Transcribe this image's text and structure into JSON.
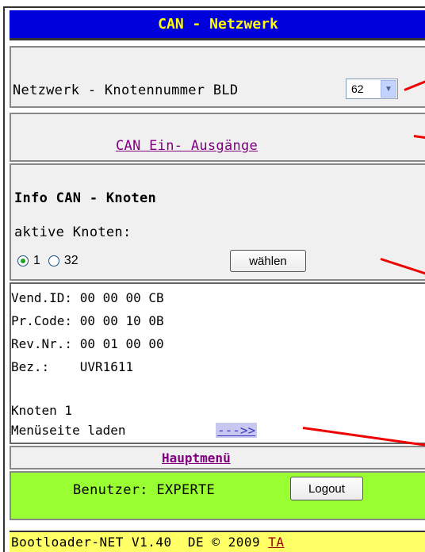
{
  "header": {
    "title": "CAN - Netzwerk"
  },
  "network": {
    "label": "Netzwerk - Knotennummer BLD",
    "selected_node": "62"
  },
  "io_link": {
    "label": "CAN Ein- Ausgänge"
  },
  "info": {
    "heading": "Info CAN - Knoten",
    "active_label": "aktive Knoten:",
    "radios": [
      {
        "label": "1",
        "checked": true
      },
      {
        "label": "32",
        "checked": false
      }
    ],
    "select_button": "wählen"
  },
  "device": {
    "lines": [
      "Vend.ID: 00 00 00 CB",
      "Pr.Code: 00 00 10 0B",
      "Rev.Nr.: 00 01 00 00",
      "Bez.:    UVR1611"
    ],
    "node_label": "Knoten 1",
    "load_label": "Menüseite laden",
    "load_link": "--->>"
  },
  "main_menu": {
    "label": "Hauptmenü"
  },
  "user": {
    "label": "Benutzer: EXPERTE",
    "logout_button": "Logout"
  },
  "footer": {
    "text": "Bootloader-NET V1.40  DE © 2009 ",
    "link": "TA"
  },
  "colors": {
    "title_bg": "#0000dd",
    "title_fg": "#ffff00",
    "user_bg": "#99ff33",
    "footer_bg": "#ffff66",
    "link": "#800080",
    "callout_lines": "#ee0000"
  }
}
